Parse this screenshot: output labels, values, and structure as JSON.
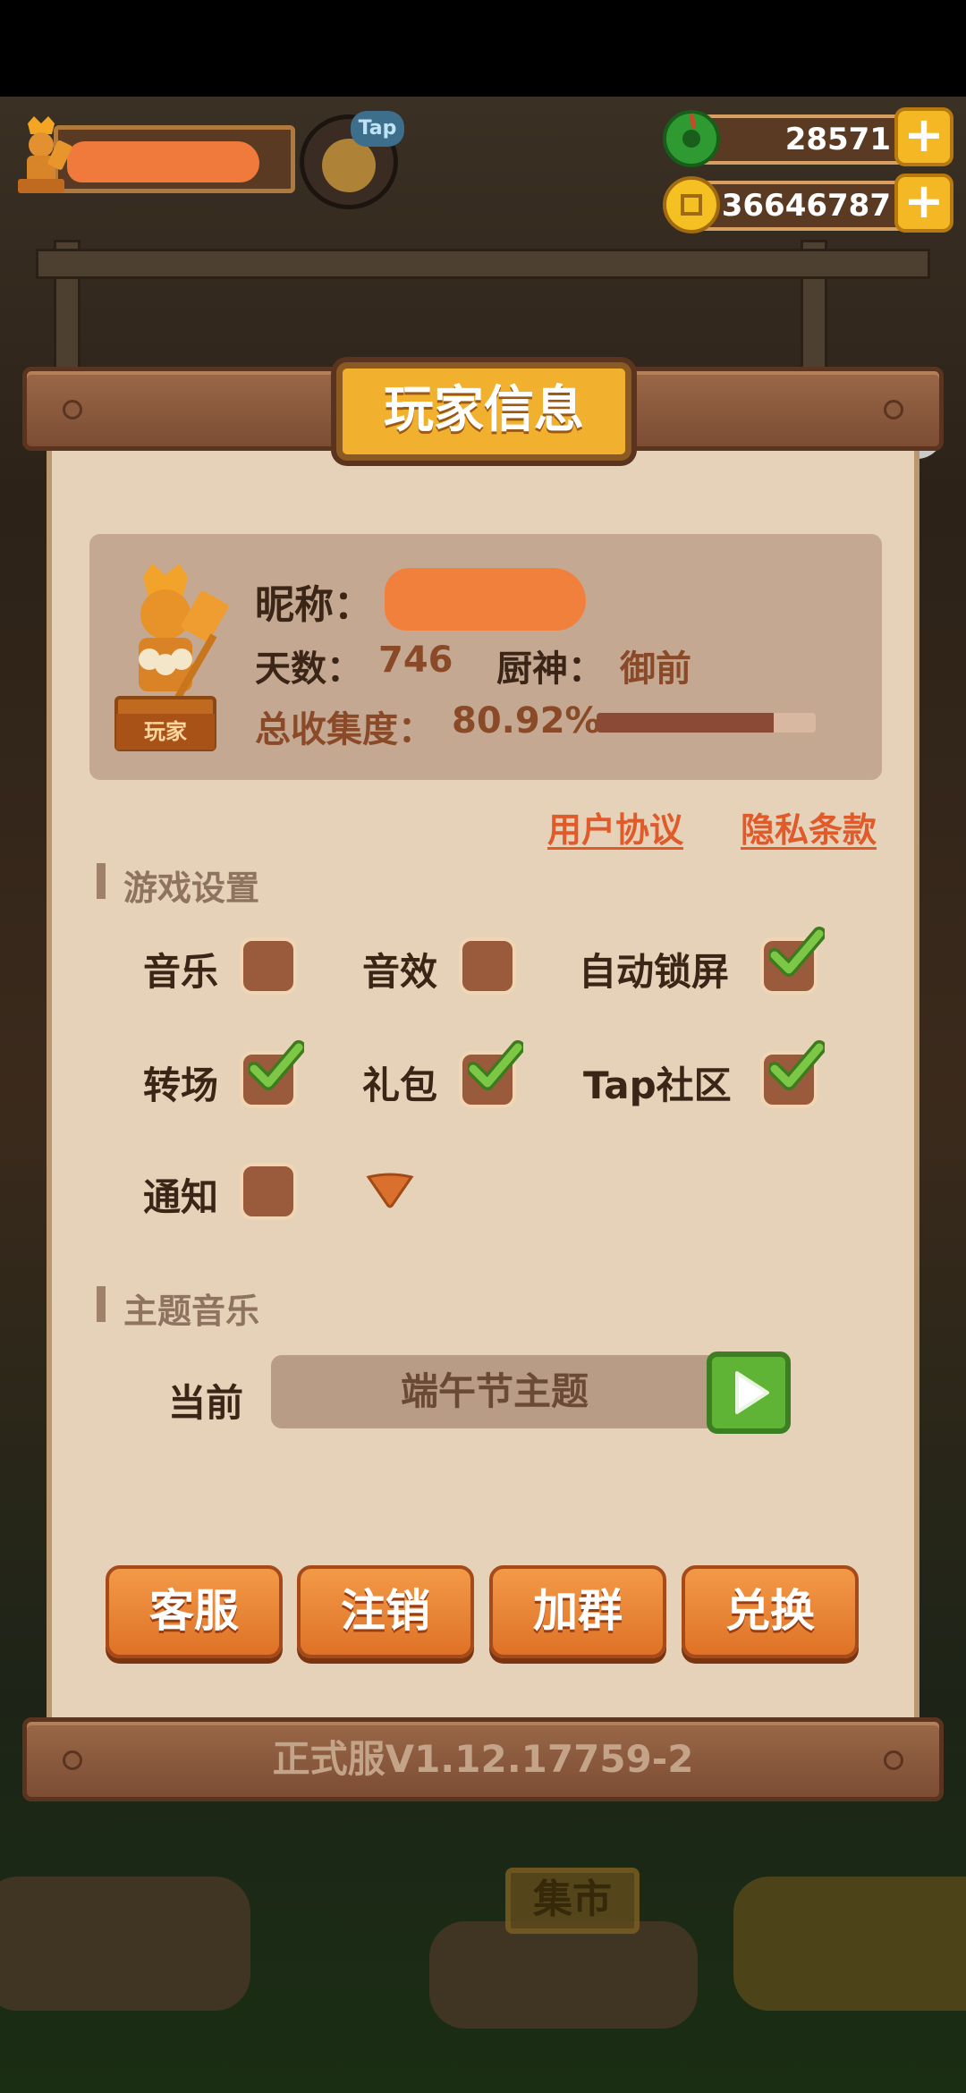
{
  "top_bar": {
    "jade_amount": "28571",
    "coin_amount": "36646787",
    "tap_badge": "Tap",
    "plus_label": "+"
  },
  "panel": {
    "title": "玩家信息",
    "statue_label": "玩家",
    "nickname_label": "昵称：",
    "days_label": "天数：",
    "days_value": "746",
    "chef_god_label": "厨神：",
    "chef_god_value": "御前",
    "collection_label": "总收集度：",
    "collection_value": "80.92%",
    "collection_fraction": 0.8092,
    "user_agreement": "用户协议",
    "privacy_policy": "隐私条款"
  },
  "settings": {
    "section_title": "游戏设置",
    "options": [
      {
        "label": "音乐",
        "checked": false
      },
      {
        "label": "音效",
        "checked": false
      },
      {
        "label": "自动锁屏",
        "checked": true
      },
      {
        "label": "转场",
        "checked": true
      },
      {
        "label": "礼包",
        "checked": true
      },
      {
        "label": "Tap社区",
        "checked": true
      },
      {
        "label": "通知",
        "checked": false
      }
    ]
  },
  "theme_music": {
    "section_title": "主题音乐",
    "current_label": "当前",
    "current_value": "端午节主题"
  },
  "buttons": {
    "customer_service": "客服",
    "logout": "注销",
    "join_group": "加群",
    "redeem": "兑换"
  },
  "version": "正式服V1.12.17759-2",
  "background": {
    "market_sign": "集市"
  },
  "colors": {
    "panel_bg": "#e5d2b8",
    "wood": "#8a5a3e",
    "title_gold": "#f1b02e",
    "button_orange": "#e8832f",
    "check_green": "#5fb436",
    "link_orange": "#e05a2a"
  },
  "icons": [
    "jade-icon",
    "coin-icon",
    "plus-icon",
    "chef-statue-icon",
    "check-icon",
    "dropdown-arrow-icon",
    "play-icon",
    "avatar-icon"
  ]
}
